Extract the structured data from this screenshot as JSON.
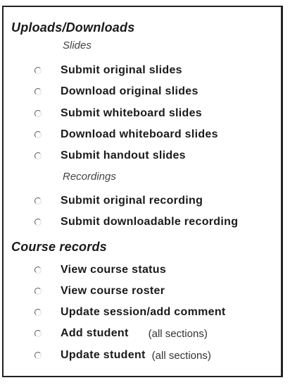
{
  "uploads": {
    "heading": "Uploads/Downloads",
    "slides_heading": "Slides",
    "recordings_heading": "Recordings",
    "slides_options": [
      {
        "label": "Submit original slides"
      },
      {
        "label": "Download original slides"
      },
      {
        "label": "Submit whiteboard slides"
      },
      {
        "label": "Download whiteboard slides"
      },
      {
        "label": "Submit handout slides"
      }
    ],
    "recordings_options": [
      {
        "label": "Submit original recording"
      },
      {
        "label": "Submit downloadable recording"
      }
    ]
  },
  "course": {
    "heading": "Course records",
    "options": [
      {
        "label": "View course status",
        "note": ""
      },
      {
        "label": "View course roster",
        "note": ""
      },
      {
        "label": "Update session/add comment",
        "note": ""
      },
      {
        "label": "Add student",
        "note": "(all sections)"
      },
      {
        "label": "Update student",
        "note": "(all sections)"
      }
    ]
  }
}
